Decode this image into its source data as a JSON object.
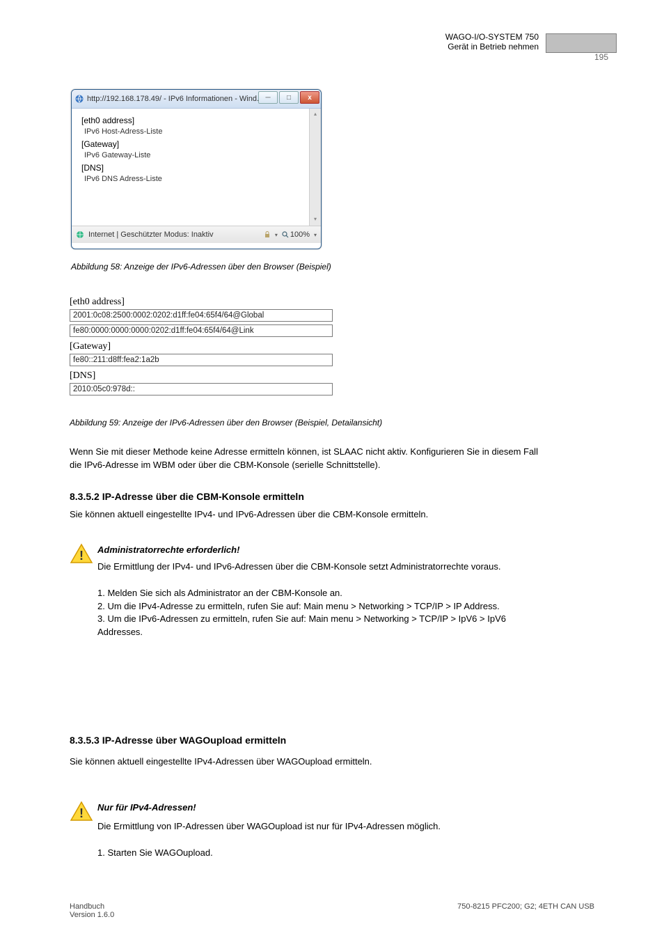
{
  "page": {
    "number": "195",
    "header_line1": "WAGO-I/O-SYSTEM 750",
    "header_line2": "Gerät in Betrieb nehmen"
  },
  "screenshot1": {
    "url_title": "http://192.168.178.49/ - IPv6 Informationen - Wind...",
    "line1": "[eth0 address]",
    "desc1": "IPv6 Host-Adress-Liste",
    "line2": "[Gateway]",
    "desc2": "IPv6 Gateway-Liste",
    "line3": "[DNS]",
    "desc3": "IPv6 DNS Adress-Liste",
    "status_text": "Internet | Geschützter Modus: Inaktiv",
    "zoom": "100%",
    "min_btn": "─",
    "max_btn": "□",
    "close_btn": "x"
  },
  "caption1": "Abbildung 58: Anzeige der IPv6-Adressen über den Browser (Beispiel)",
  "detail": {
    "h1": "[eth0 address]",
    "c1": "2001:0c08:2500:0002:0202:d1ff:fe04:65f4/64@Global",
    "c2": "fe80:0000:0000:0000:0202:d1ff:fe04:65f4/64@Link",
    "h2": "[Gateway]",
    "c3": "fe80::211:d8ff:fea2:1a2b",
    "h3": "[DNS]",
    "c4": "2010:05c0:978d::"
  },
  "caption2": "Abbildung 59: Anzeige der IPv6-Adressen über den Browser (Beispiel, Detailansicht)",
  "body1": "Wenn Sie mit dieser Methode keine Adresse ermitteln können, ist SLAAC nicht aktiv. Konfigurieren Sie in diesem Fall die IPv6-Adresse im WBM oder über die CBM-Konsole (serielle Schnittstelle).",
  "sec1": "8.3.5.2  IP-Adresse über die CBM-Konsole ermitteln",
  "body2": "Sie können aktuell eingestellte IPv4- und IPv6-Adressen über die CBM-Konsole ermitteln.",
  "warn1_title": "Administratorrechte erforderlich!",
  "warn1_body": "Die Ermittlung der IPv4- und IPv6-Adressen über die CBM-Konsole setzt Administratorrechte voraus.\n\n1. Melden Sie sich als Administrator an der CBM-Konsole an.\n2. Um die IPv4-Adresse zu ermitteln, rufen Sie auf: Main menu > Networking > TCP/IP > IP Address.\n3. Um die IPv6-Adressen zu ermitteln, rufen Sie auf: Main menu > Networking > TCP/IP > IpV6 > IpV6 Addresses.",
  "sec2": "8.3.5.3  IP-Adresse über WAGOupload ermitteln",
  "body3": "Sie können aktuell eingestellte IPv4-Adressen über WAGOupload ermitteln.",
  "warn2_title": "Nur für IPv4-Adressen!",
  "warn2_body": "Die Ermittlung von IP-Adressen über WAGOupload ist nur für IPv4-Adressen möglich.\n\n1. Starten Sie WAGOupload.",
  "footer_left": "Handbuch\nVersion 1.6.0",
  "footer_right": "750-8215 PFC200; G2; 4ETH CAN USB"
}
